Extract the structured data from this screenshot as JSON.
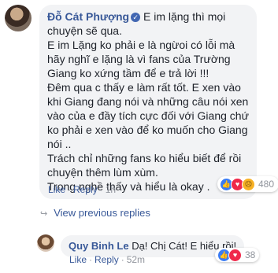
{
  "comment": {
    "author": "Đỗ Cát Phượng",
    "verified_badge": "✓",
    "paragraphs": [
      "E im lặng thì mọi chuyện sẽ qua.",
      "E im Lặng ko phải e là ngừoi có lỗi mà hãy nghĩ e lặng là vì fans của Trường Giang ko xứng tầm để e trả lời !!!",
      "Đêm qua c thấy e làm rất tốt. E xen vào khi Giang đang nói và những câu nói xen vào của e đầy tích cực đối với Giang chứ ko phải e xen vào để ko muốn cho Giang nói ..",
      "Trách chỉ những fans ko hiểu biết để rồi chuyện thêm lùm xùm.",
      "Trong nghề thấy và hiểu là okay ."
    ],
    "actions": {
      "like": "Like",
      "reply": "Reply",
      "time": "1h"
    },
    "reaction_count": "480"
  },
  "view_previous": "View previous replies",
  "reply": {
    "author": "Quy Binh Le",
    "text": "Dạ! Chị Cát! E hiểu rồi!",
    "actions": {
      "like": "Like",
      "reply": "Reply",
      "time": "52m"
    },
    "reaction_count": "38"
  },
  "icons": {
    "like_reaction": "👍",
    "love_reaction": "♥",
    "sad_reaction": "☹",
    "reply_arrow": "↩"
  },
  "colors": {
    "link": "#385898",
    "muted": "#90949c",
    "bubble": "#f2f3f5",
    "like_blue": "#3b7cf3",
    "love_red": "#f0284a",
    "sad_yellow": "#f7b125"
  }
}
